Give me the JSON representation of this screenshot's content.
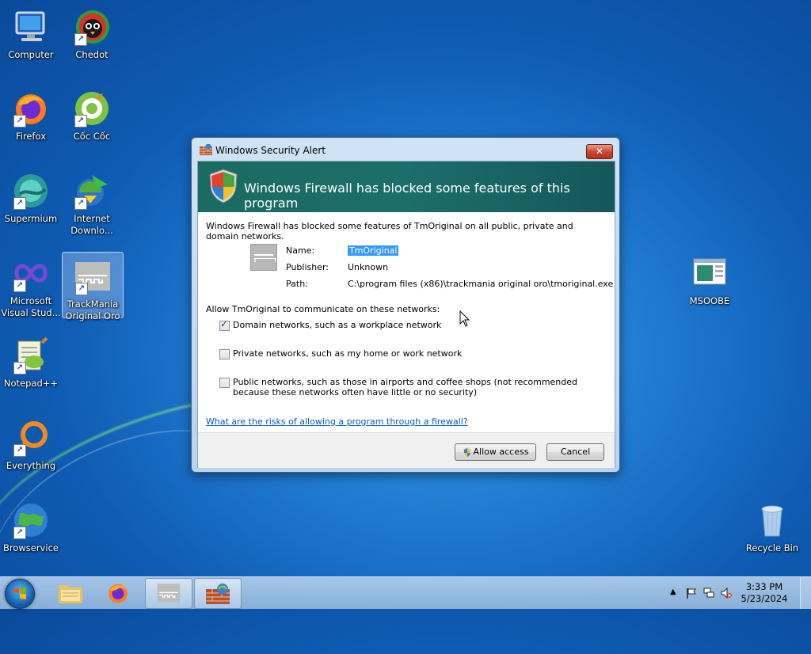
{
  "desktop": {
    "icons": [
      {
        "label": "Computer"
      },
      {
        "label": "Chedot"
      },
      {
        "label": "Firefox"
      },
      {
        "label": "Cốc Cốc"
      },
      {
        "label": "Supermium"
      },
      {
        "label": "Internet Downlo..."
      },
      {
        "label": "Microsoft Visual Stud..."
      },
      {
        "label": "TrackMania Original Oro"
      },
      {
        "label": "Notepad++"
      },
      {
        "label": "Everything"
      },
      {
        "label": "Browservice"
      },
      {
        "label": "MSOOBE"
      },
      {
        "label": "Recycle Bin"
      }
    ]
  },
  "dialog": {
    "title": "Windows Security Alert",
    "close_label": "✕",
    "banner_text": "Windows Firewall has blocked some features of this program",
    "intro": "Windows Firewall has blocked some features of TmOriginal on all public, private and domain networks.",
    "fields": {
      "name_label": "Name:",
      "name_value": "TmOriginal",
      "publisher_label": "Publisher:",
      "publisher_value": "Unknown",
      "path_label": "Path:",
      "path_value": "C:\\program files (x86)\\trackmania original oro\\tmoriginal.exe"
    },
    "networks_label": "Allow TmOriginal to communicate on these networks:",
    "networks": [
      {
        "label": "Domain networks, such as a workplace network",
        "checked": true
      },
      {
        "label": "Private networks, such as my home or work network",
        "checked": false
      },
      {
        "label": "Public networks, such as those in airports and coffee shops (not recommended",
        "label2": "because these networks often have little or no security)",
        "checked": false
      }
    ],
    "risk_link": "What are the risks of allowing a program through a firewall?",
    "allow_label": "Allow access",
    "cancel_label": "Cancel"
  },
  "taskbar": {
    "clock_time": "3:33 PM",
    "clock_date": "5/23/2024"
  }
}
